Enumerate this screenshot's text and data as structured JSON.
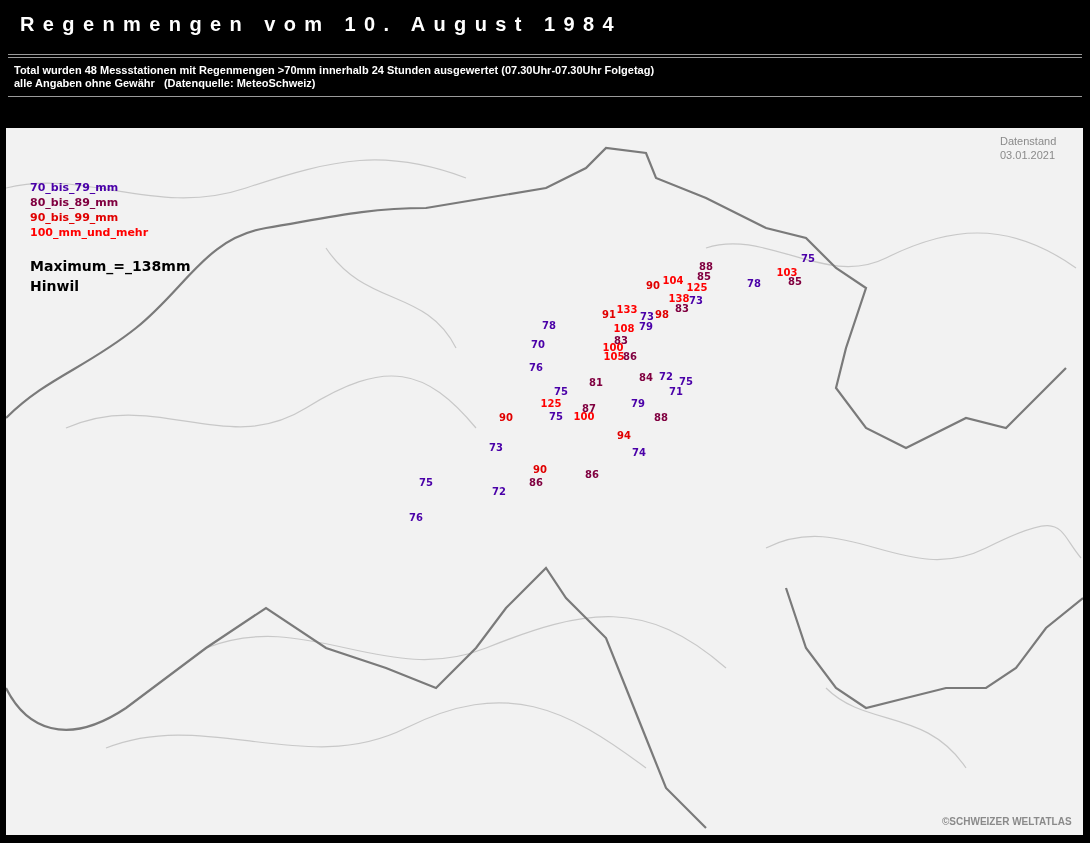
{
  "title": "Regenmengen vom 10. August 1984",
  "info_lines": [
    "Total wurden 48 Messstationen mit Regenmengen >70mm innerhalb 24 Stunden ausgewertet (07.30Uhr-07.30Uhr Folgetag)",
    "alle Angaben ohne Gewähr   (Datenquelle: MeteoSchweiz)"
  ],
  "map": {
    "data_date": [
      "Datenstand",
      "03.01.2021"
    ],
    "legend": [
      {
        "label": "70_bis_79_mm",
        "color": "#4a00a8"
      },
      {
        "label": "80_bis_89_mm",
        "color": "#800040"
      },
      {
        "label": "90_bis_99_mm",
        "color": "#e00000"
      },
      {
        "label": "100_mm_und_mehr",
        "color": "#ff0000"
      }
    ],
    "maximum": "Maximum_=_138mm",
    "maximum_location": "Hinwil",
    "stations": [
      {
        "value": "88",
        "color": "#800040"
      },
      {
        "value": "103",
        "color": "#ff0000"
      },
      {
        "value": "75",
        "color": "#4a00a8"
      },
      {
        "value": "90",
        "color": "#e00000"
      },
      {
        "value": "104",
        "color": "#ff0000"
      },
      {
        "value": "85",
        "color": "#800040"
      },
      {
        "value": "125",
        "color": "#ff0000"
      },
      {
        "value": "78",
        "color": "#4a00a8"
      },
      {
        "value": "85",
        "color": "#800040"
      },
      {
        "value": "138",
        "color": "#ff0000"
      },
      {
        "value": "73",
        "color": "#4a00a8"
      },
      {
        "value": "91",
        "color": "#e00000"
      },
      {
        "value": "133",
        "color": "#ff0000"
      },
      {
        "value": "73",
        "color": "#4a00a8"
      },
      {
        "value": "98",
        "color": "#e00000"
      },
      {
        "value": "83",
        "color": "#800040"
      },
      {
        "value": "78",
        "color": "#4a00a8"
      },
      {
        "value": "108",
        "color": "#ff0000"
      },
      {
        "value": "79",
        "color": "#4a00a8"
      },
      {
        "value": "70",
        "color": "#4a00a8"
      },
      {
        "value": "83",
        "color": "#800040"
      },
      {
        "value": "100",
        "color": "#ff0000"
      },
      {
        "value": "105",
        "color": "#ff0000"
      },
      {
        "value": "86",
        "color": "#800040"
      },
      {
        "value": "76",
        "color": "#4a00a8"
      },
      {
        "value": "81",
        "color": "#800040"
      },
      {
        "value": "84",
        "color": "#800040"
      },
      {
        "value": "72",
        "color": "#4a00a8"
      },
      {
        "value": "75",
        "color": "#4a00a8"
      },
      {
        "value": "75",
        "color": "#4a00a8"
      },
      {
        "value": "71",
        "color": "#4a00a8"
      },
      {
        "value": "125",
        "color": "#ff0000"
      },
      {
        "value": "87",
        "color": "#800040"
      },
      {
        "value": "79",
        "color": "#4a00a8"
      },
      {
        "value": "90",
        "color": "#e00000"
      },
      {
        "value": "75",
        "color": "#4a00a8"
      },
      {
        "value": "100",
        "color": "#ff0000"
      },
      {
        "value": "88",
        "color": "#800040"
      },
      {
        "value": "94",
        "color": "#e00000"
      },
      {
        "value": "73",
        "color": "#4a00a8"
      },
      {
        "value": "74",
        "color": "#4a00a8"
      },
      {
        "value": "90",
        "color": "#e00000"
      },
      {
        "value": "86",
        "color": "#800040"
      },
      {
        "value": "75",
        "color": "#4a00a8"
      },
      {
        "value": "86",
        "color": "#800040"
      },
      {
        "value": "72",
        "color": "#4a00a8"
      },
      {
        "value": "76",
        "color": "#4a00a8"
      }
    ],
    "copyright": "©SCHWEIZER WELTATLAS"
  }
}
